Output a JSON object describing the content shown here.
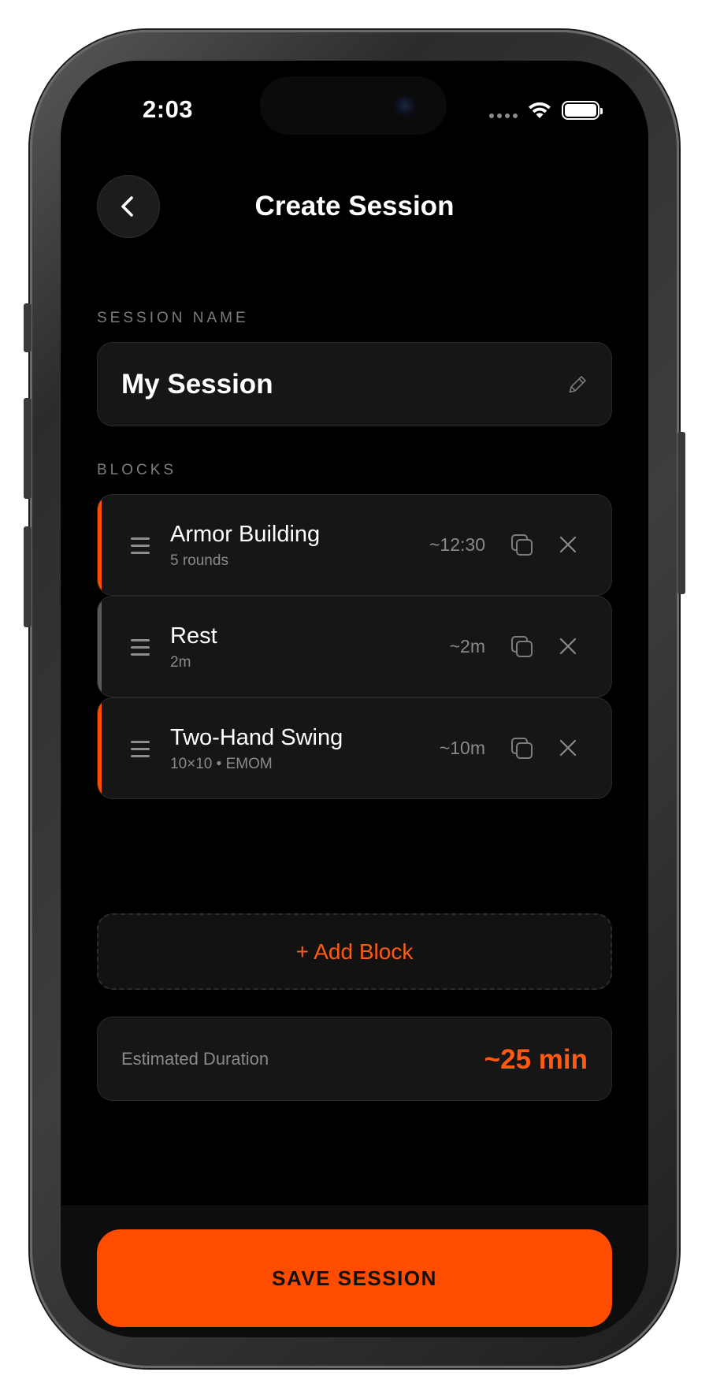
{
  "status_bar": {
    "time": "2:03"
  },
  "header": {
    "title": "Create Session"
  },
  "session_name": {
    "label": "SESSION NAME",
    "value": "My Session"
  },
  "blocks_section": {
    "label": "BLOCKS",
    "items": [
      {
        "title": "Armor Building",
        "subtitle": "5 rounds",
        "duration": "~12:30",
        "accent": "#ff4d00"
      },
      {
        "title": "Rest",
        "subtitle": "2m",
        "duration": "~2m",
        "accent": "#5a5a5a"
      },
      {
        "title": "Two-Hand Swing",
        "subtitle": "10×10 • EMOM",
        "duration": "~10m",
        "accent": "#ff4d00"
      }
    ]
  },
  "add_block": {
    "label": "+ Add Block"
  },
  "estimate": {
    "label": "Estimated Duration",
    "value": "~25 min"
  },
  "save": {
    "label": "SAVE SESSION"
  },
  "colors": {
    "accent": "#ff4d00",
    "background": "#000000",
    "card": "#161616"
  },
  "icons": [
    "back-chevron-icon",
    "pencil-icon",
    "drag-handle-icon",
    "copy-icon",
    "close-icon",
    "wifi-icon",
    "battery-icon"
  ]
}
